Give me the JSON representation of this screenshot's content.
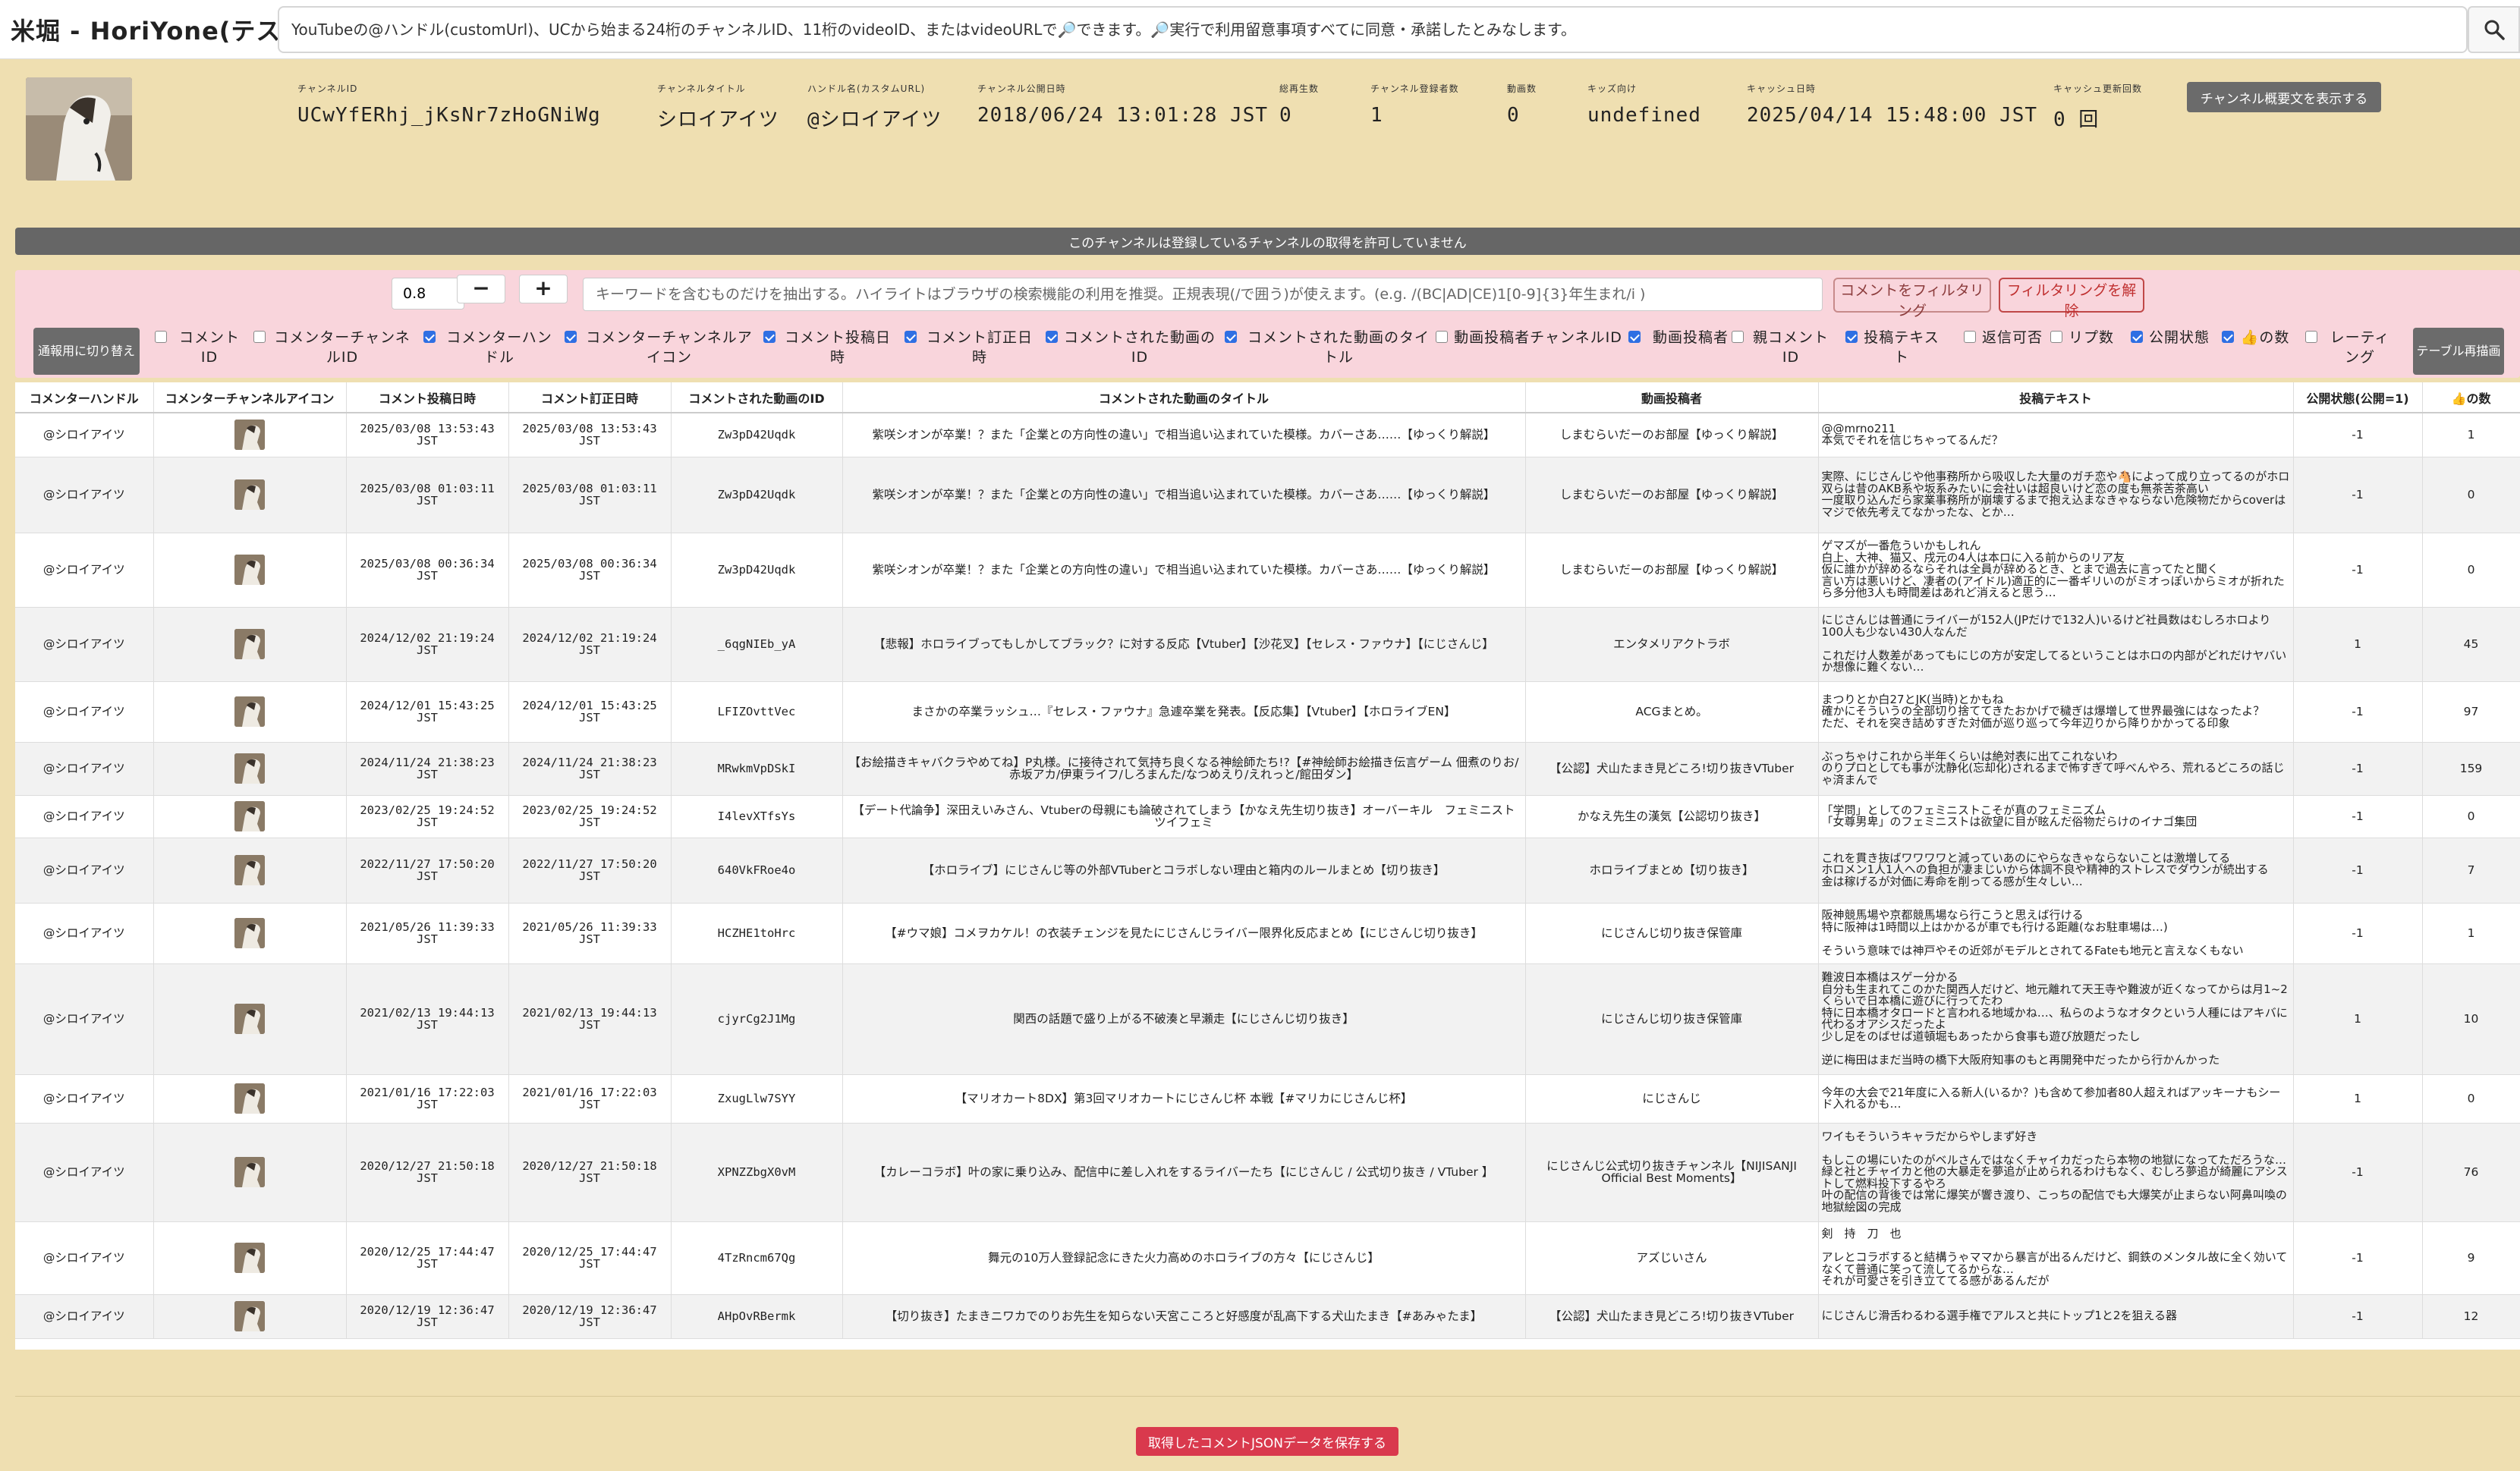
{
  "app": {
    "title": "米堀 - HoriYone(テスト中)"
  },
  "search": {
    "placeholder": "YouTubeの@ハンドル(customUrl)、UCから始まる24桁のチャンネルID、11桁のvideoID、またはvideoURLで🔎できます。🔎実行で利用留意事項すべてに同意・承諾したとみなします。"
  },
  "channel": {
    "fields": [
      {
        "label": "チャンネルID",
        "value": "UCwYfERhj_jKsNr7zHoGNiWg"
      },
      {
        "label": "チャンネルタイトル",
        "value": "シロイアイツ"
      },
      {
        "label": "ハンドル名(カスタムURL)",
        "value": "@シロイアイツ"
      },
      {
        "label": "チャンネル公開日時",
        "value": "2018/06/24 13:01:28 JST"
      },
      {
        "label": "総再生数",
        "value": "0"
      },
      {
        "label": "チャンネル登録者数",
        "value": "1"
      },
      {
        "label": "動画数",
        "value": "0"
      },
      {
        "label": "キッズ向け",
        "value": "undefined"
      },
      {
        "label": "キャッシュ日時",
        "value": "2025/04/14 15:48:00 JST"
      },
      {
        "label": "キャッシュ更新回数",
        "value": "0 回"
      }
    ],
    "show_desc_label": "チャンネル概要文を表示する"
  },
  "notice": "このチャンネルは登録しているチャンネルの取得を許可していません",
  "controls": {
    "threshold_value": "0.8",
    "minus_label": "−",
    "plus_label": "+",
    "keyword_placeholder": "キーワードを含むものだけを抽出する。ハイライトはブラウザの検索機能の利用を推奨。正規表現(/で囲う)が使えます。(e.g. /(BC|AD|CE)1[0-9]{3}年生まれ/i )",
    "filter_label": "コメントをフィルタリング",
    "unfilter_label": "フィルタリングを解除",
    "switch_label": "通報用に切り替え",
    "redraw_label": "テーブル再描画",
    "columns": [
      {
        "label": "コメントID",
        "checked": false
      },
      {
        "label": "コメンターチャンネルID",
        "checked": false
      },
      {
        "label": "コメンターハンドル",
        "checked": true
      },
      {
        "label": "コメンターチャンネルアイコン",
        "checked": true
      },
      {
        "label": "コメント投稿日時",
        "checked": true
      },
      {
        "label": "コメント訂正日時",
        "checked": true
      },
      {
        "label": "コメントされた動画のID",
        "checked": true
      },
      {
        "label": "コメントされた動画のタイトル",
        "checked": true
      },
      {
        "label": "動画投稿者チャンネルID",
        "checked": false
      },
      {
        "label": "動画投稿者",
        "checked": true
      },
      {
        "label": "親コメントID",
        "checked": false
      },
      {
        "label": "投稿テキスト",
        "checked": true
      },
      {
        "label": "返信可否",
        "checked": false
      },
      {
        "label": "リプ数",
        "checked": false
      },
      {
        "label": "公開状態",
        "checked": true
      },
      {
        "label": "👍の数",
        "checked": true
      },
      {
        "label": "レーティング",
        "checked": false
      }
    ]
  },
  "table": {
    "headers": [
      "コメンターハンドル",
      "コメンターチャンネルアイコン",
      "コメント投稿日時",
      "コメント訂正日時",
      "コメントされた動画のID",
      "コメントされた動画のタイトル",
      "動画投稿者",
      "投稿テキスト",
      "公開状態(公開=1)",
      "👍の数"
    ],
    "rows": [
      {
        "handle": "@シロイアイツ",
        "posted": "2025/03/08 13:53:43\nJST",
        "edited": "2025/03/08 13:53:43\nJST",
        "video_id": "Zw3pD42Uqdk",
        "title": "紫咲シオンが卒業！？また「企業との方向性の違い」で相当追い込まれていた模様。カバーさあ……【ゆっくり解説】",
        "author": "しまむらいだーのお部屋【ゆっくり解説】",
        "text": "@@mrno211\n本気でそれを信じちゃってるんだ？",
        "status": "-1",
        "likes": "1"
      },
      {
        "handle": "@シロイアイツ",
        "posted": "2025/03/08 01:03:11\nJST",
        "edited": "2025/03/08 01:03:11\nJST",
        "video_id": "Zw3pD42Uqdk",
        "title": "紫咲シオンが卒業！？また「企業との方向性の違い」で相当追い込まれていた模様。カバーさあ……【ゆっくり解説】",
        "author": "しまむらいだーのお部屋【ゆっくり解説】",
        "text": "実際、にじさんじや他事務所から吸収した大量のガチ恋や🐴によって成り立ってるのがホロ\n双らは昔のAKB系や坂系みたいに会社いは超良いけど恋の度も無茶苦茶高い\n一度取り込んだら家業事務所が崩壊するまで抱え込まなきゃならない危険物だからcoverはマジで依先考えてなかったな、とか…",
        "status": "-1",
        "likes": "0"
      },
      {
        "handle": "@シロイアイツ",
        "posted": "2025/03/08 00:36:34\nJST",
        "edited": "2025/03/08 00:36:34\nJST",
        "video_id": "Zw3pD42Uqdk",
        "title": "紫咲シオンが卒業！？また「企業との方向性の違い」で相当追い込まれていた模様。カバーさあ……【ゆっくり解説】",
        "author": "しまむらいだーのお部屋【ゆっくり解説】",
        "text": "ゲマズが一番危ういかもしれん\n白上、大神、猫又、戌元の4人は本ロに入る前からのリア友\n仮に誰かが辞めるならそれは全員が辞めるとき、とまで過去に言ってたと聞く\n言い方は悪いけど、凄者の(アイドル)適正的に一番ギリいのがミオっぽいからミオが折れたら多分他3人も時間差はあれど消えると思う…",
        "status": "-1",
        "likes": "0"
      },
      {
        "handle": "@シロイアイツ",
        "posted": "2024/12/02 21:19:24\nJST",
        "edited": "2024/12/02 21:19:24\nJST",
        "video_id": "_6qgNIEb_yA",
        "title": "【悲報】ホロライブってもしかしてブラック？に対する反応【Vtuber】【沙花叉】【セレス・ファウナ】【にじさんじ】",
        "author": "エンタメリアクトラボ",
        "text": "にじさんじは普通にライバーが152人(JPだけで132人)いるけど社員数はむしろホロより100人も少ない430人なんだ\n\nこれだけ人数差があってもにじの方が安定してるということはホロの内部がどれだけヤバいか想像に難くない…",
        "status": "1",
        "likes": "45"
      },
      {
        "handle": "@シロイアイツ",
        "posted": "2024/12/01 15:43:25\nJST",
        "edited": "2024/12/01 15:43:25\nJST",
        "video_id": "LFIZOvttVec",
        "title": "まさかの卒業ラッシュ…『セレス・ファウナ』急遽卒業を発表。【反応集】【Vtuber】【ホロライブEN】",
        "author": "ACGまとめ。",
        "text": "まつりとか白27とJK(当時)とかもね\n確かにそういうの全部切り捨ててきたおかげで穢ぎは爆増して世界最強にはなったよ？\nただ、それを突き詰めすぎた対価が巡り巡って今年辺りから降りかかってる印象",
        "status": "-1",
        "likes": "97"
      },
      {
        "handle": "@シロイアイツ",
        "posted": "2024/11/24 21:38:23\nJST",
        "edited": "2024/11/24 21:38:23\nJST",
        "video_id": "MRwkmVpDSkI",
        "title": "【お絵描きキャバクラやめてね】P丸様。に接待されて気持ち良くなる神絵師たち!?【#神絵師お絵描き伝言ゲーム 佃煮のりお/赤坂アカ/伊東ライフ/しろまんた/なつめえり/えれっと/館田ダン】",
        "author": "【公認】犬山たまき見どころ!切り抜きVTuber",
        "text": "ぶっちゃけこれから半年くらいは絶対表に出てこれないわ\nのりプロとしても事が沈静化(忘却化)されるまで怖すぎて呼べんやろ、荒れるどころの話じゃ済まんで",
        "status": "-1",
        "likes": "159"
      },
      {
        "handle": "@シロイアイツ",
        "posted": "2023/02/25 19:24:52\nJST",
        "edited": "2023/02/25 19:24:52\nJST",
        "video_id": "I4levXTfsYs",
        "title": "【デート代論争】深田えいみさん、Vtuberの母親にも論破されてしまう【かなえ先生切り抜き】オーバーキル　フェミニスト　ツイフェミ",
        "author": "かなえ先生の漢気【公認切り抜き】",
        "text": "「学問」としてのフェミニストこそが真のフェミニズム\n「女尊男卑」のフェミニストは欲望に目が眩んだ俗物だらけのイナゴ集団",
        "status": "-1",
        "likes": "0"
      },
      {
        "handle": "@シロイアイツ",
        "posted": "2022/11/27 17:50:20\nJST",
        "edited": "2022/11/27 17:50:20\nJST",
        "video_id": "640VkFRoe4o",
        "title": "【ホロライブ】にじさんじ等の外部VTuberとコラボしない理由と箱内のルールまとめ【切り抜き】",
        "author": "ホロライブまとめ【切り抜き】",
        "text": "これを貫き抜ばワワワワと減っていあのにやらなきゃならないことは激増してる\nホロメン1人1人への負担が凄まじいから体調不良や精神的ストレスでダウンが続出する\n金は稼げるが対価に寿命を削ってる感が生々しい…",
        "status": "-1",
        "likes": "7"
      },
      {
        "handle": "@シロイアイツ",
        "posted": "2021/05/26 11:39:33\nJST",
        "edited": "2021/05/26 11:39:33\nJST",
        "video_id": "HCZHE1toHrc",
        "title": "【#ウマ娘】コメヲカケル！の衣装チェンジを見たにじさんじライバー限界化反応まとめ【にじさんじ切り抜き】",
        "author": "にじさんじ切り抜き保管庫",
        "text": "阪神競馬場や京都競馬場なら行こうと思えば行ける\n特に阪神は1時間以上はかかるが車でも行ける距離(なお駐車場は…)\n\nそういう意味では神戸やその近郊がモデルとされてるFateも地元と言えなくもない",
        "status": "-1",
        "likes": "1"
      },
      {
        "handle": "@シロイアイツ",
        "posted": "2021/02/13 19:44:13\nJST",
        "edited": "2021/02/13 19:44:13\nJST",
        "video_id": "cjyrCg2J1Mg",
        "title": "関西の話題で盛り上がる不破湊と早瀬走【にじさんじ切り抜き】",
        "author": "にじさんじ切り抜き保管庫",
        "text": "難波日本橋はスゲー分かる\n自分も生まれてこのかた関西人だけど、地元離れて天王寺や難波が近くなってからは月1~2くらいで日本橋に遊びに行ってたわ\n特に日本橋オタロードと言われる地域かね…、私らのようなオタクという人種にはアキバに代わるオアシスだったよ\n少し足をのばせば道頓堀もあったから食事も遊び放題だったし\n\n逆に梅田はまだ当時の橋下大阪府知事のもと再開発中だったから行かんかった",
        "status": "1",
        "likes": "10"
      },
      {
        "handle": "@シロイアイツ",
        "posted": "2021/01/16 17:22:03\nJST",
        "edited": "2021/01/16 17:22:03\nJST",
        "video_id": "ZxugLlw7SYY",
        "title": "【マリオカート8DX】第3回マリオカートにじさんじ杯 本戦【#マリカにじさんじ杯】",
        "author": "にじさんじ",
        "text": "今年の大会で21年度に入る新人(いるか？)も含めて参加者80人超えればアッキーナもシード入れるかも…",
        "status": "1",
        "likes": "0"
      },
      {
        "handle": "@シロイアイツ",
        "posted": "2020/12/27 21:50:18\nJST",
        "edited": "2020/12/27 21:50:18\nJST",
        "video_id": "XPNZZbgX0vM",
        "title": "【カレーコラボ】叶の家に乗り込み、配信中に差し入れをするライバーたち【にじさんじ / 公式切り抜き / VTuber 】",
        "author": "にじさんじ公式切り抜きチャンネル【NIJISANJI Official Best Moments】",
        "text": "ワイもそういうキャラだからやしまず好き\n\nもしこの場にいたのがベルさんではなくチャイカだったら本物の地獄になってただろうな…\n緑と社とチャイカと他の大暴走を夢追が止められるわけもなく、むしろ夢追が綺麗にアシストして燃料投下するやろ\n叶の配信の背後では常に爆笑が響き渡り、こっちの配信でも大爆笑が止まらない阿鼻叫喚の地獄絵図の完成",
        "status": "-1",
        "likes": "76"
      },
      {
        "handle": "@シロイアイツ",
        "posted": "2020/12/25 17:44:47\nJST",
        "edited": "2020/12/25 17:44:47\nJST",
        "video_id": "4TzRncm67Qg",
        "title": "舞元の10万人登録記念にきた火力高めのホロライブの方々【にじさんじ】",
        "author": "アズじいさん",
        "text": "剣　持　刀　也\n\nアレとコラボすると結構うゃママから暴言が出るんだけど、鋼鉄のメンタル故に全く効いてなくて普通に笑って流してるからな…\nそれが可愛さを引き立ててる感があるんだが",
        "status": "-1",
        "likes": "9"
      },
      {
        "handle": "@シロイアイツ",
        "posted": "2020/12/19 12:36:47\nJST",
        "edited": "2020/12/19 12:36:47\nJST",
        "video_id": "AHpOvRBermk",
        "title": "【切り抜き】たまきニワカでのりお先生を知らない天宮こころと好感度が乱高下する犬山たまき【#あみゃたま】",
        "author": "【公認】犬山たまき見どころ!切り抜きVTuber",
        "text": "にじさんじ滑舌わるわる選手権でアルスと共にトップ1と2を狙える器",
        "status": "-1",
        "likes": "12"
      }
    ]
  },
  "save_label": "取得したコメントJSONデータを保存する"
}
